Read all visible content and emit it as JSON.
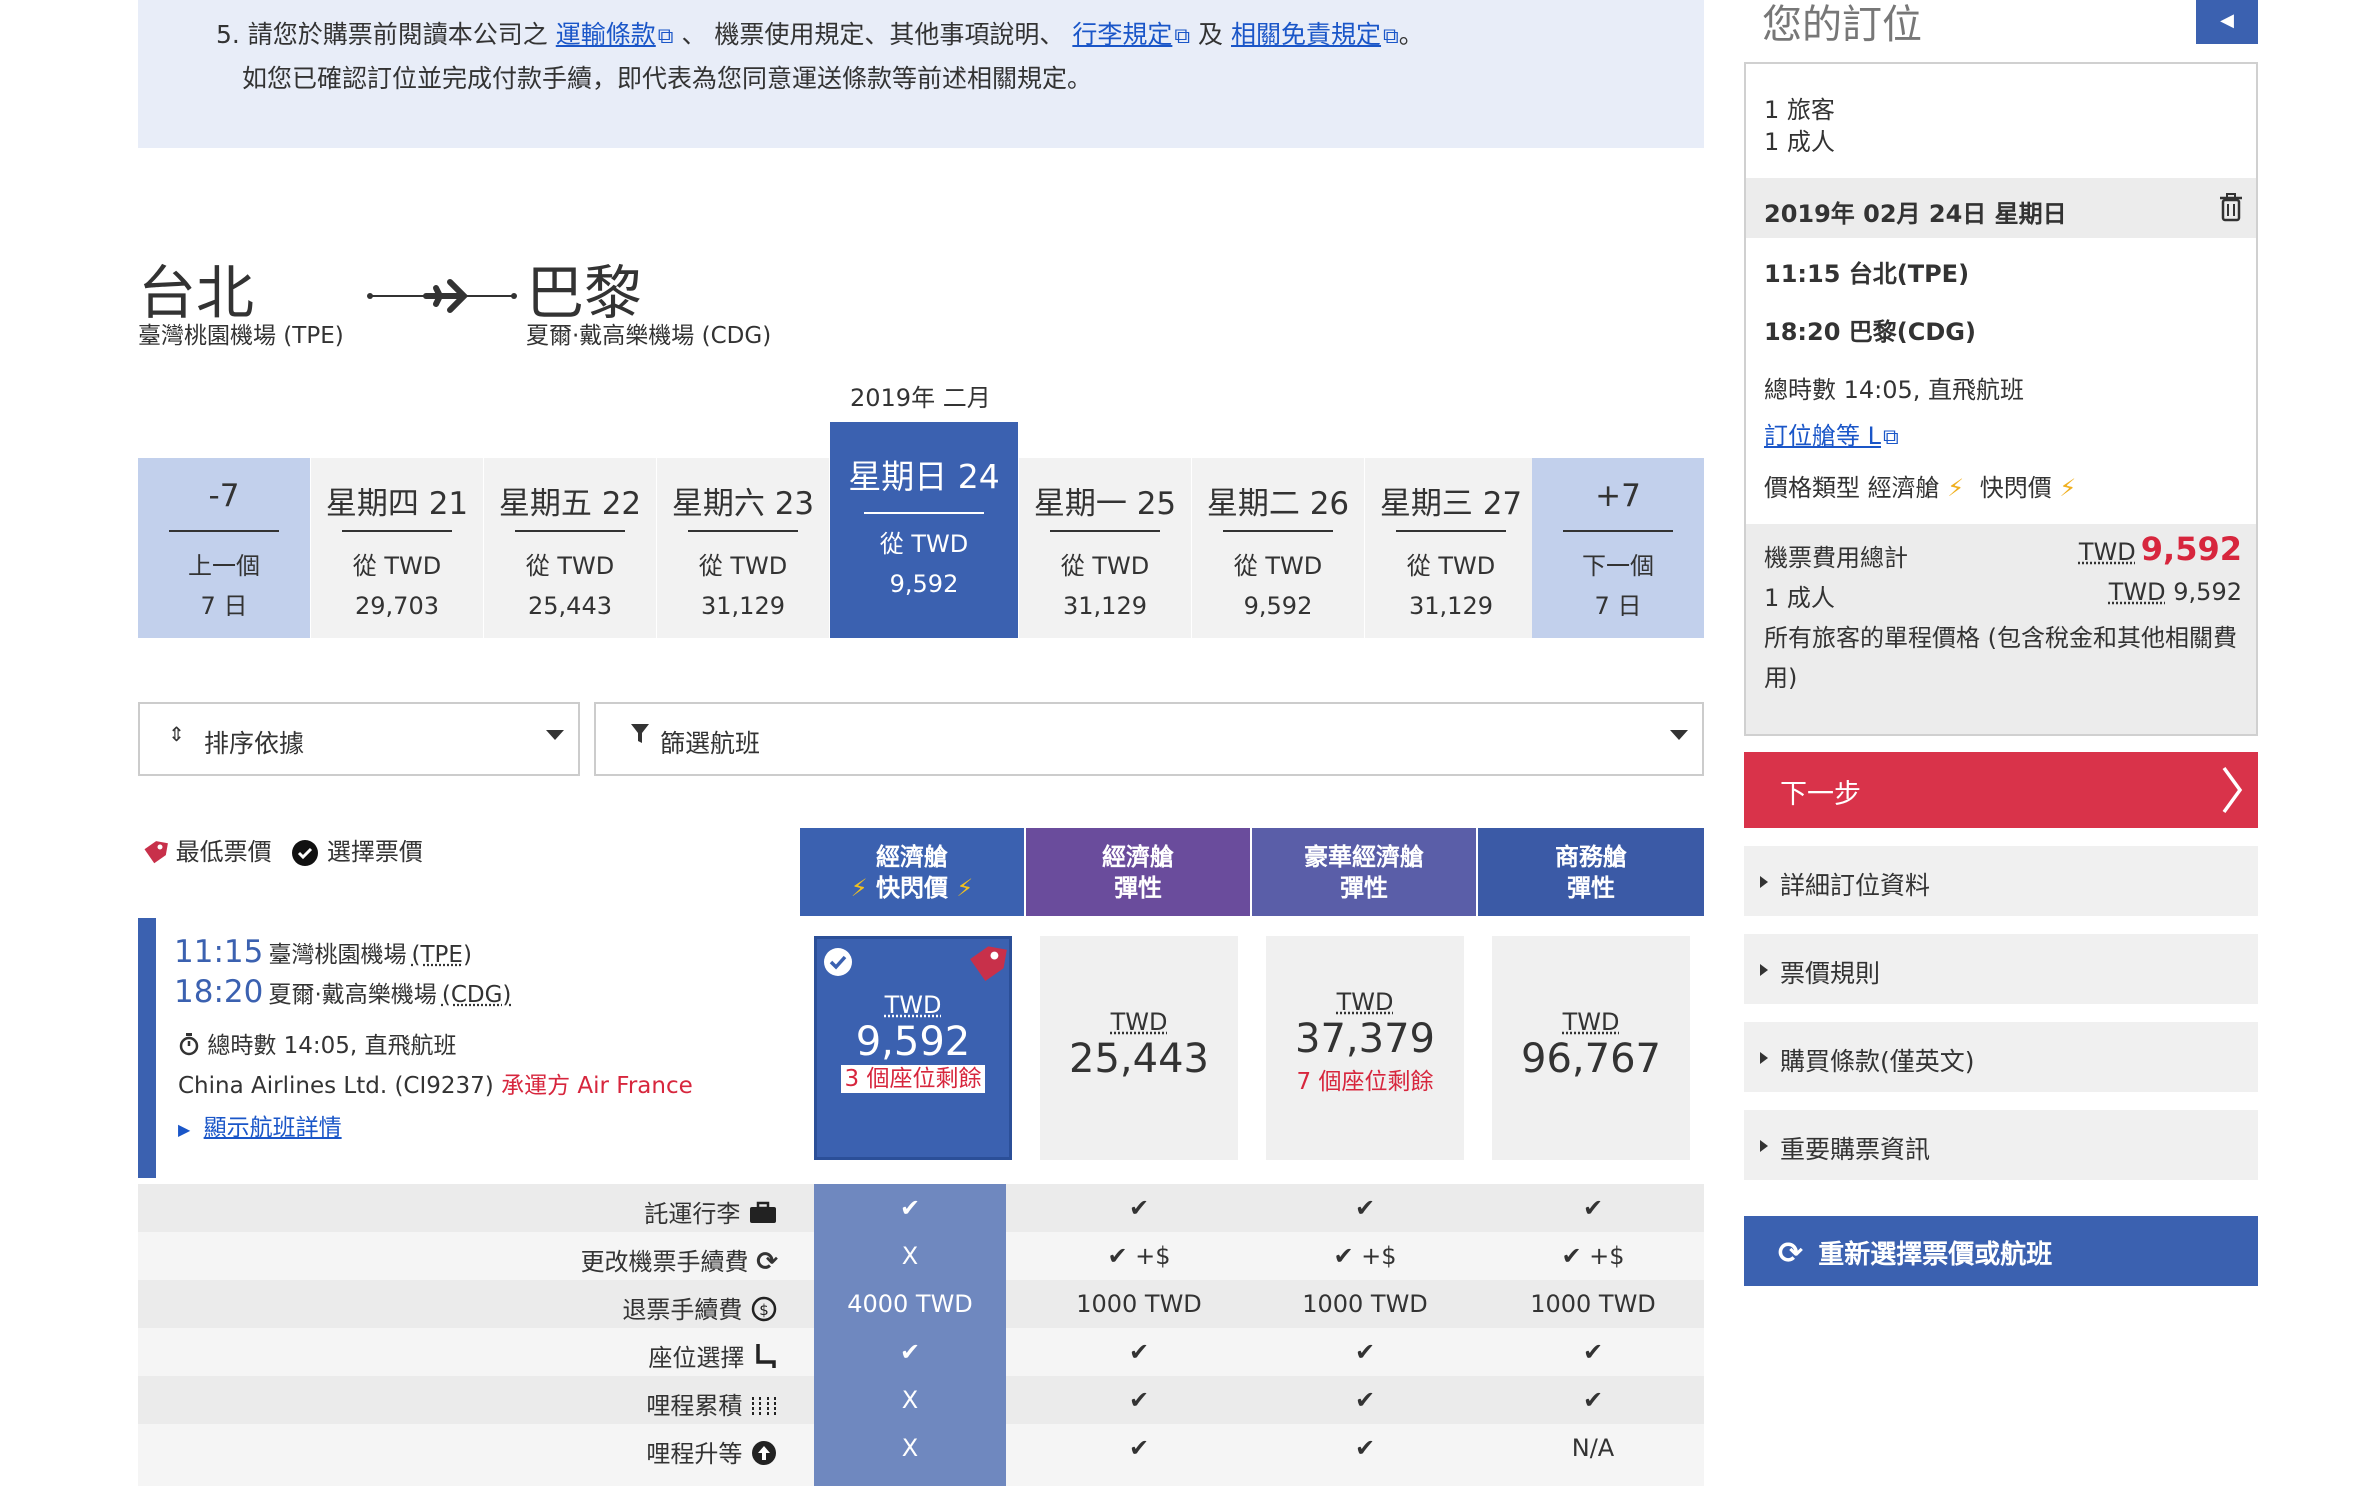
{
  "notice": {
    "line1_prefix": "5. 請您於購票前閱讀本公司之",
    "link_carriage": "運輸條款",
    "mid1": "、 機票使用規定、其他事項說明、",
    "link_baggage": "行李規定",
    "mid2": "及",
    "link_disclaimer": "相關免責規定",
    "end1": "。",
    "line2": "如您已確認訂位並完成付款手續，即代表為您同意運送條款等前述相關規定。"
  },
  "route": {
    "origin_city": "台北",
    "origin_airport": "臺灣桃園機場 (TPE)",
    "dest_city": "巴黎",
    "dest_airport": "夏爾·戴高樂機場 (CDG)"
  },
  "calendar": {
    "month_label": "2019年 二月",
    "prev": {
      "head": "-7",
      "line1": "上一個",
      "line2": "7 日"
    },
    "next": {
      "head": "+7",
      "line1": "下一個",
      "line2": "7 日"
    },
    "days": [
      {
        "head": "星期四 21",
        "line1": "從 TWD",
        "line2": "29,703"
      },
      {
        "head": "星期五 22",
        "line1": "從 TWD",
        "line2": "25,443"
      },
      {
        "head": "星期六 23",
        "line1": "從 TWD",
        "line2": "31,129"
      },
      {
        "head": "星期日 24",
        "line1": "從 TWD",
        "line2": "9,592"
      },
      {
        "head": "星期一 25",
        "line1": "從 TWD",
        "line2": "31,129"
      },
      {
        "head": "星期二 26",
        "line1": "從 TWD",
        "line2": "9,592"
      },
      {
        "head": "星期三 27",
        "line1": "從 TWD",
        "line2": "31,129"
      }
    ]
  },
  "controls": {
    "sort_label": "排序依據",
    "filter_label": "篩選航班"
  },
  "legend": {
    "lowest": "最低票價",
    "selected": "選擇票價"
  },
  "fare_headers": [
    {
      "line1": "經濟艙",
      "line2": "快閃價",
      "color": "#3b61b0"
    },
    {
      "line1": "經濟艙",
      "line2": "彈性",
      "color": "#6a4c9c"
    },
    {
      "line1": "豪華經濟艙",
      "line2": "彈性",
      "color": "#5a5ea8"
    },
    {
      "line1": "商務艙",
      "line2": "彈性",
      "color": "#3b5aa6"
    }
  ],
  "flight": {
    "dep_time": "11:15",
    "dep_airport": "臺灣桃園機場",
    "dep_code": "(TPE)",
    "arr_time": "18:20",
    "arr_airport": "夏爾·戴高樂機場",
    "arr_code": "(CDG)",
    "duration": "總時數 14:05, 直飛航班",
    "carrier": "China Airlines Ltd. (CI9237)",
    "operated": "承運方 Air France",
    "details_link": "顯示航班詳情"
  },
  "fares": [
    {
      "currency": "TWD",
      "amount": "9,592",
      "seats": "3 個座位剩餘"
    },
    {
      "currency": "TWD",
      "amount": "25,443",
      "seats": ""
    },
    {
      "currency": "TWD",
      "amount": "37,379",
      "seats": "7 個座位剩餘"
    },
    {
      "currency": "TWD",
      "amount": "96,767",
      "seats": ""
    }
  ],
  "features": [
    {
      "label": "託運行李",
      "icon": "suitcase-icon",
      "values": [
        "✔",
        "✔",
        "✔",
        "✔"
      ]
    },
    {
      "label": "更改機票手續費",
      "icon": "refresh-icon",
      "values": [
        "X",
        "✔ +$",
        "✔ +$",
        "✔ +$"
      ]
    },
    {
      "label": "退票手續費",
      "icon": "refund-icon",
      "values": [
        "4000 TWD",
        "1000 TWD",
        "1000 TWD",
        "1000 TWD"
      ]
    },
    {
      "label": "座位選擇",
      "icon": "seat-icon",
      "values": [
        "✔",
        "✔",
        "✔",
        "✔"
      ]
    },
    {
      "label": "哩程累積",
      "icon": "miles-icon",
      "values": [
        "X",
        "✔",
        "✔",
        "✔"
      ]
    },
    {
      "label": "哩程升等",
      "icon": "upgrade-icon",
      "values": [
        "X",
        "✔",
        "✔",
        "N/A"
      ]
    }
  ],
  "sidebar": {
    "title": "您的訂位",
    "travellers": "1 旅客",
    "adults": "1 成人",
    "date": "2019年 02月 24日 星期日",
    "dep": "11:15 台北(TPE)",
    "arr": "18:20 巴黎(CDG)",
    "duration": "總時數 14:05, 直飛航班",
    "booking_class": "訂位艙等 L",
    "fare_type_label": "價格類型",
    "fare_type_1": "經濟艙",
    "fare_type_2": "快閃價",
    "total_label": "機票費用總計",
    "total_currency": "TWD",
    "total_amount": "9,592",
    "adult_label": "1 成人",
    "adult_currency": "TWD",
    "adult_amount": "9,592",
    "tax_note": "所有旅客的單程價格 (包含稅金和其他相關費用)",
    "next_button": "下一步",
    "accordion": [
      "詳細訂位資料",
      "票價規則",
      "購買條款(僅英文)",
      "重要購票資訊"
    ],
    "reselect_button": "重新選擇票價或航班"
  },
  "colors": {
    "accent_blue": "#3b61b0",
    "red": "#d7263d",
    "next_button": "#d9334a"
  }
}
